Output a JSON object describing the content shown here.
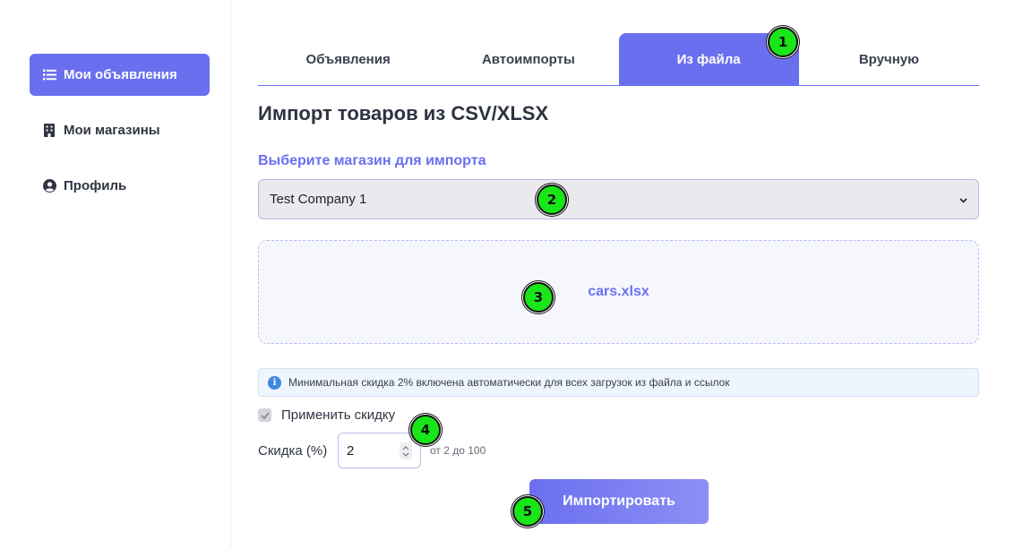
{
  "sidebar": {
    "items": [
      {
        "label": "Мои объявления",
        "icon": "list-icon",
        "active": true
      },
      {
        "label": "Мои магазины",
        "icon": "building-icon",
        "active": false
      },
      {
        "label": "Профиль",
        "icon": "user-circle-icon",
        "active": false
      }
    ]
  },
  "tabs": [
    {
      "label": "Объявления",
      "active": false
    },
    {
      "label": "Автоимпорты",
      "active": false
    },
    {
      "label": "Из файла",
      "active": true
    },
    {
      "label": "Вручную",
      "active": false
    }
  ],
  "main": {
    "heading": "Импорт товаров из CSV/XLSX",
    "store_label": "Выберите магазин для импорта",
    "store_value": "Test Company 1",
    "file_name": "cars.xlsx",
    "info_text": "Минимальная скидка 2% включена автоматически для всех загрузок из файла и ссылок",
    "apply_discount_label": "Применить скидку",
    "apply_discount_checked": true,
    "discount_label": "Скидка (%)",
    "discount_value": "2",
    "discount_hint": "от 2 до 100",
    "import_button": "Импортировать"
  },
  "markers": [
    "1",
    "2",
    "3",
    "4",
    "5"
  ],
  "colors": {
    "accent": "#6a6ff0",
    "marker": "#19e619",
    "info_bg": "#eef5fc",
    "info_icon": "#3f86e0"
  }
}
